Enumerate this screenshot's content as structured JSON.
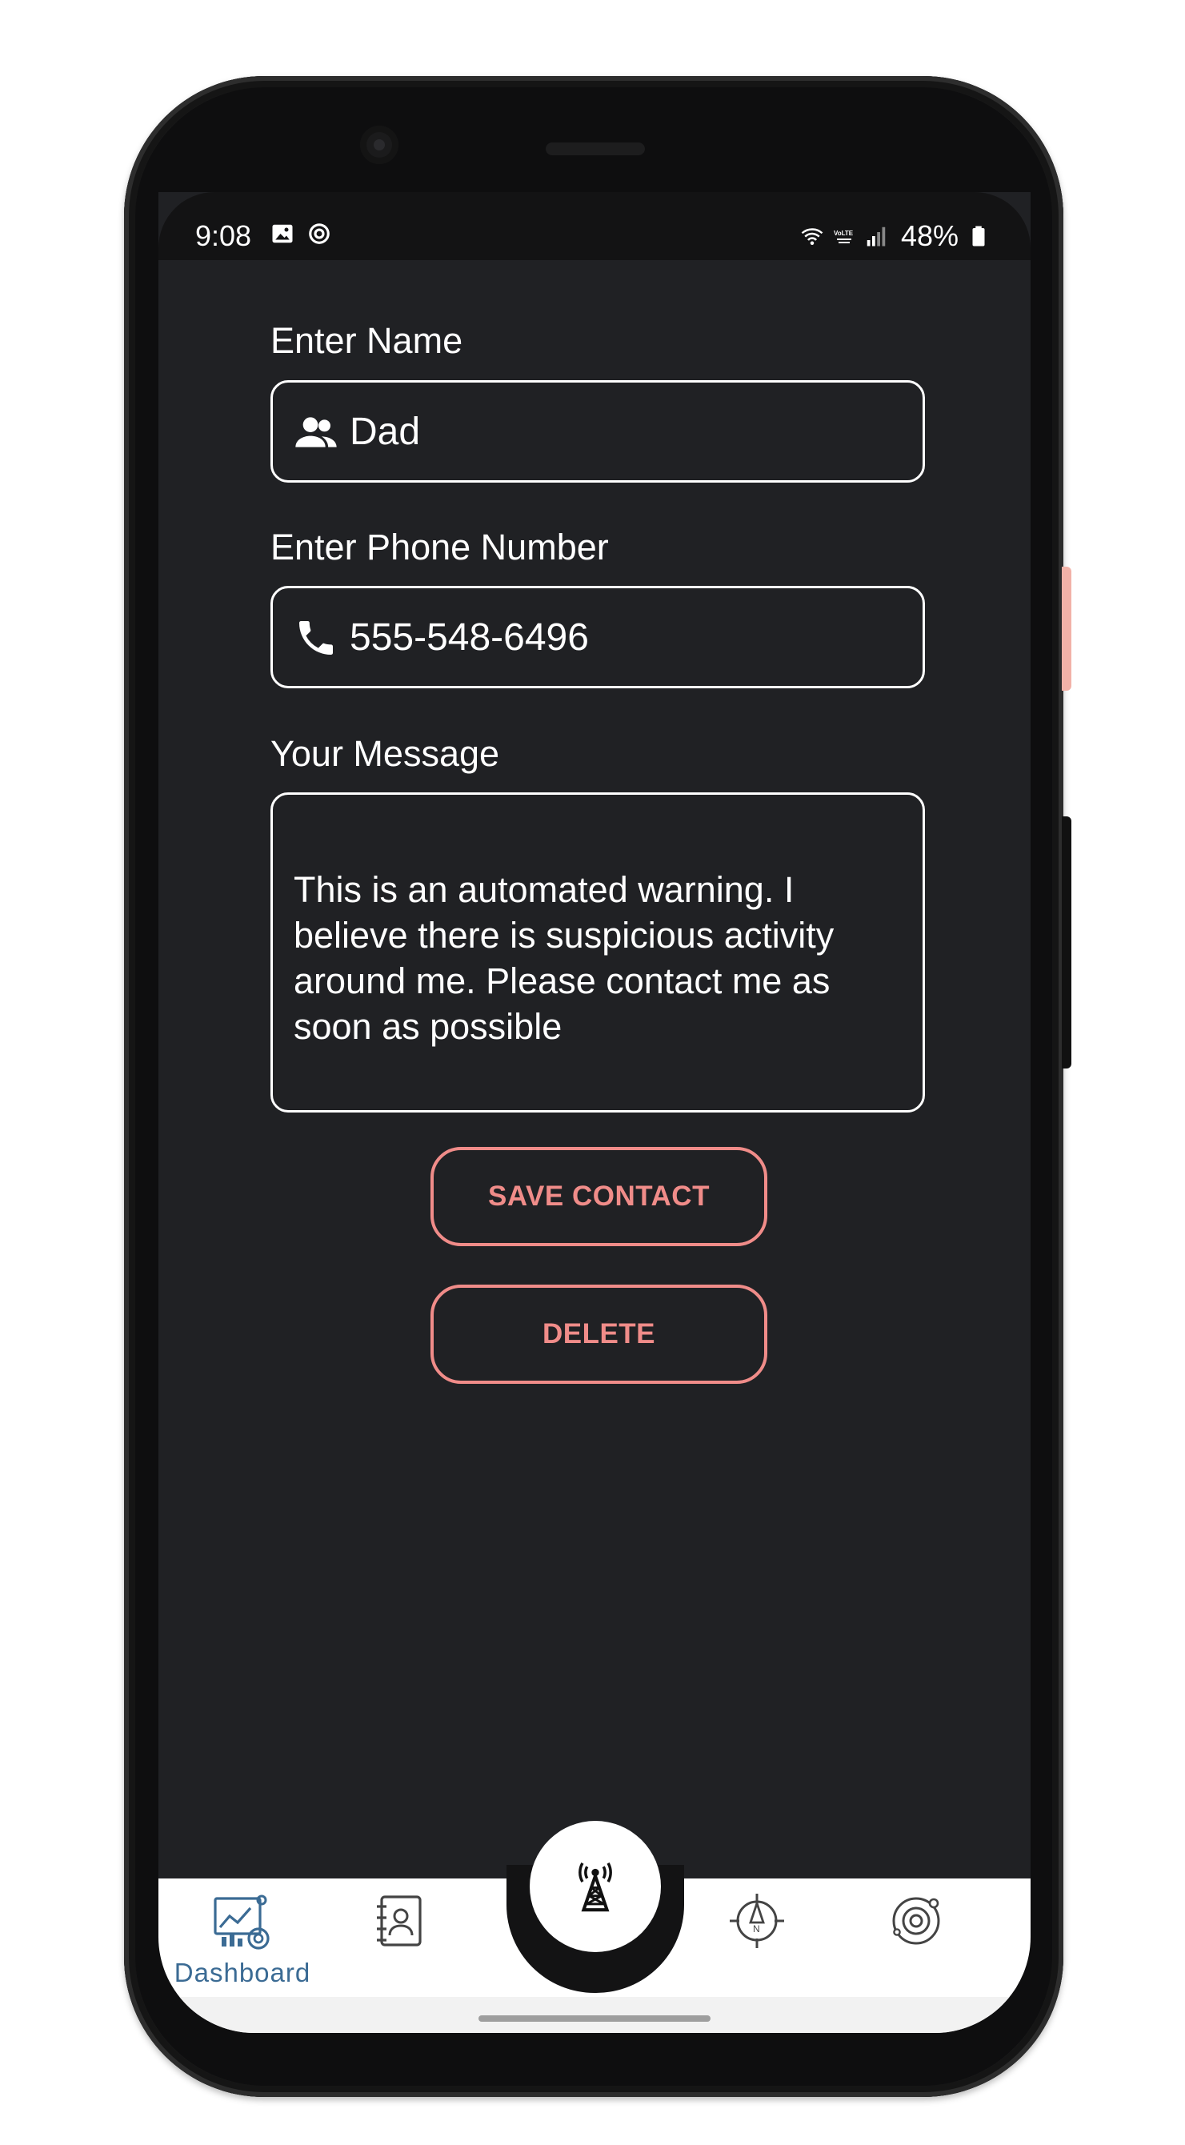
{
  "status_bar": {
    "time": "9:08",
    "battery": "48%",
    "icons": [
      "image-icon",
      "sync-icon",
      "wifi-icon",
      "volte-icon",
      "signal-icon",
      "battery-icon"
    ]
  },
  "form": {
    "name": {
      "label": "Enter Name",
      "value": "Dad",
      "icon": "people-icon"
    },
    "phone": {
      "label": "Enter Phone Number",
      "value": "555-548-6496",
      "icon": "phone-icon"
    },
    "message": {
      "label": "Your Message",
      "value": "This is an automated warning. I believe there is suspicious activity around me. Please contact me as soon as possible"
    }
  },
  "buttons": {
    "save": "SAVE CONTACT",
    "delete": "DELETE"
  },
  "bottom_nav": {
    "items": [
      {
        "label": "Dashboard",
        "icon": "dashboard-icon",
        "active": true
      },
      {
        "label": "",
        "icon": "contacts-book-icon",
        "active": false
      },
      {
        "label": "",
        "icon": "radio-tower-icon",
        "active": false
      },
      {
        "label": "",
        "icon": "compass-icon",
        "active": false
      },
      {
        "label": "",
        "icon": "orbit-settings-icon",
        "active": false
      }
    ]
  },
  "colors": {
    "background": "#202124",
    "accent": "#f08c89",
    "nav_active": "#3b6b94"
  }
}
